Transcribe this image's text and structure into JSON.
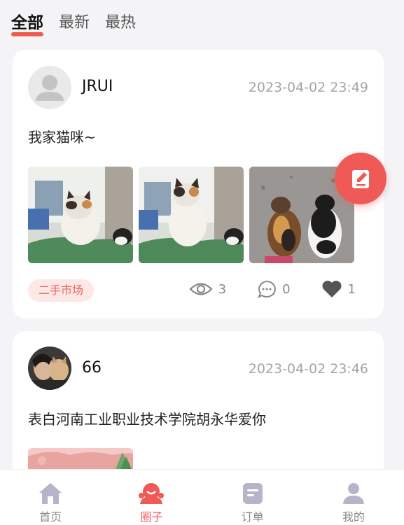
{
  "tabs": [
    {
      "label": "全部",
      "active": true
    },
    {
      "label": "最新",
      "active": false
    },
    {
      "label": "最热",
      "active": false
    }
  ],
  "posts": [
    {
      "username": "JRUI",
      "time": "2023-04-02 23:49",
      "content": "我家猫咪~",
      "tag": "二手市场",
      "views": "3",
      "comments": "0",
      "likes": "1"
    },
    {
      "username": "66",
      "time": "2023-04-02 23:46",
      "content": "表白河南工业职业技术学院胡永华爱你"
    }
  ],
  "nav": [
    {
      "label": "首页",
      "icon": "home-icon",
      "active": false
    },
    {
      "label": "圈子",
      "icon": "circle-icon",
      "active": true
    },
    {
      "label": "订单",
      "icon": "order-icon",
      "active": false
    },
    {
      "label": "我的",
      "icon": "user-icon",
      "active": false
    }
  ],
  "colors": {
    "accent": "#ef5a57",
    "tag_bg": "#fde8e6",
    "tag_text": "#e8655a",
    "nav_inactive": "#b8b4c8"
  }
}
